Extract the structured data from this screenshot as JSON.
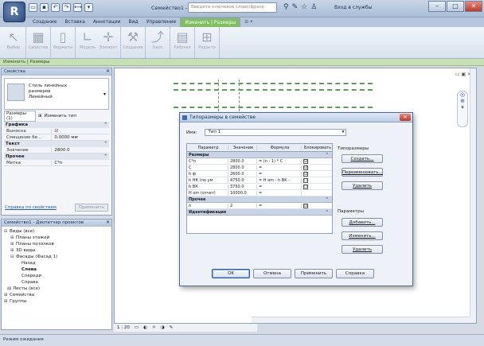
{
  "window": {
    "app_button": "R",
    "title": "Семейство1 - Ф...",
    "search_placeholder": "Введите ключевое слово/фразу",
    "signin": "Вход в службы",
    "minimize": "–",
    "maximize": "□",
    "close": "✕"
  },
  "ribbon": {
    "tabs": [
      "Создание",
      "Вставка",
      "Аннотации",
      "Вид",
      "Управление",
      "Изменить | Размеры",
      "⊙ •"
    ],
    "active_tab_index": 5,
    "buttons": [
      {
        "label": "Выбор",
        "icon": "cursor-icon"
      },
      {
        "label": "Свойства",
        "icon": "properties-icon"
      },
      {
        "label": "Форматы",
        "icon": "format-icon"
      },
      {
        "label": "Модель",
        "icon": "model-icon"
      },
      {
        "label": "Элемент",
        "icon": "element-icon"
      },
      {
        "label": "Создание",
        "icon": "create-icon"
      },
      {
        "label": "Базо",
        "icon": "datum-icon"
      },
      {
        "label": "Рабочая",
        "icon": "workplane-icon"
      },
      {
        "label": "Редакто",
        "icon": "editor-icon"
      }
    ],
    "context_bar": "Изменить | Размеры"
  },
  "properties": {
    "title": "Свойства",
    "type_name": [
      "Стиль линейных",
      "размеров",
      "Линейный"
    ],
    "filter": "Размеры (1)",
    "edit_type": "Изменить тип",
    "groups": [
      {
        "name": "Графика",
        "rows": [
          {
            "k": "Выноска",
            "v": "☑"
          },
          {
            "k": "Смещение бе...",
            "v": "0.0000 мм"
          }
        ]
      },
      {
        "name": "Текст",
        "rows": [
          {
            "k": "Значение",
            "v": "2800.0"
          }
        ]
      },
      {
        "name": "Прочее",
        "rows": [
          {
            "k": "Метка",
            "v": "C*n"
          }
        ]
      }
    ],
    "help_link": "Справка по свойствам",
    "apply": "Применить"
  },
  "browser": {
    "title": "Семейство1 - Диспетчер проектов",
    "nodes": [
      {
        "label": "Виды (все)",
        "level": 0,
        "ex": "⊟"
      },
      {
        "label": "Планы этажей",
        "level": 1,
        "ex": "⊞"
      },
      {
        "label": "Планы потолков",
        "level": 1,
        "ex": "⊞"
      },
      {
        "label": "3D виды",
        "level": 1,
        "ex": "⊞"
      },
      {
        "label": "Фасады (Фасад 1)",
        "level": 1,
        "ex": "⊟"
      },
      {
        "label": "Назад",
        "level": 2,
        "ex": ""
      },
      {
        "label": "Слева",
        "level": 2,
        "ex": "",
        "bold": true
      },
      {
        "label": "Спереди",
        "level": 2,
        "ex": ""
      },
      {
        "label": "Справа",
        "level": 2,
        "ex": ""
      },
      {
        "label": "Листы (все)",
        "level": 0,
        "ex": ""
      },
      {
        "label": "Семейства",
        "level": 0,
        "ex": "⊞"
      },
      {
        "label": "Группы",
        "level": 0,
        "ex": "⊞"
      }
    ]
  },
  "view": {
    "scale": "1 : 20",
    "status": "Режим ожидания"
  },
  "dialog": {
    "title": "Типоразмеры в семействе",
    "name_label": "Имя:",
    "name_value": "Тип 1",
    "columns": [
      "Параметр",
      "Значение",
      "Формула",
      "Блокировать"
    ],
    "sections": [
      {
        "name": "Размеры",
        "rows": [
          {
            "p": "C*n",
            "v": "2800.0",
            "f": "= (n - 1) * C",
            "lock": "☑"
          },
          {
            "p": "C",
            "v": "2800.0",
            "f": "=",
            "lock": "☑"
          },
          {
            "p": "h ф",
            "v": "2600.0",
            "f": "=",
            "lock": "☑"
          },
          {
            "p": "h НК (по ум",
            "v": "4750.0",
            "f": "= H om - h BK - ",
            "lock": "☐"
          },
          {
            "p": "h ВК",
            "v": "3750.0",
            "f": "=",
            "lock": "☐"
          },
          {
            "p": "H om (отчет)",
            "v": "10000.0",
            "f": "=",
            "lock": ""
          }
        ]
      },
      {
        "name": "Прочее",
        "rows": [
          {
            "p": "n",
            "v": "2",
            "f": "=",
            "lock": "☑"
          }
        ]
      },
      {
        "name": "Идентификация",
        "rows": []
      }
    ],
    "side": {
      "types_label": "Типоразмеры",
      "new_btn": "Создать...",
      "rename_btn": "Переименовать...",
      "delete_btn": "Удалить",
      "params_label": "Параметры",
      "add_btn": "Добавить...",
      "modify_btn": "Изменить...",
      "delete2_btn": "Удалить"
    },
    "ok": "OK",
    "cancel": "Отмена",
    "apply": "Применить",
    "help": "Справка"
  }
}
